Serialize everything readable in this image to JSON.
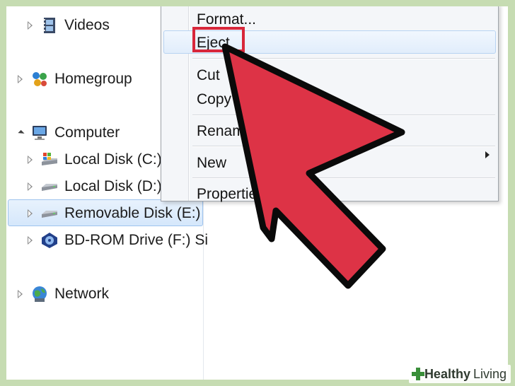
{
  "nav": {
    "items": [
      {
        "label": "Videos",
        "icon": "videos-icon"
      },
      {
        "label": "Homegroup",
        "icon": "homegroup-icon"
      },
      {
        "label": "Computer",
        "icon": "computer-icon"
      },
      {
        "label": "Local Disk (C:)",
        "icon": "windows-disk-icon"
      },
      {
        "label": "Local Disk (D:)",
        "icon": "hard-disk-icon"
      },
      {
        "label": "Removable Disk (E:)",
        "icon": "removable-disk-icon"
      },
      {
        "label": "BD-ROM Drive (F:) Si",
        "icon": "bd-rom-icon"
      },
      {
        "label": "Network",
        "icon": "network-icon"
      }
    ]
  },
  "context_menu": {
    "items": [
      {
        "label": "Format..."
      },
      {
        "label": "Eject"
      },
      {
        "label": "Cut"
      },
      {
        "label": "Copy"
      },
      {
        "label": "Renam"
      },
      {
        "label": "New"
      },
      {
        "label": "Propertie"
      }
    ]
  },
  "watermark": {
    "brand_bold": "Healthy",
    "brand_light": "Living"
  },
  "colors": {
    "arrow": "#dd3346",
    "highlight": "#d8273b",
    "background": "#c6dcb2"
  }
}
